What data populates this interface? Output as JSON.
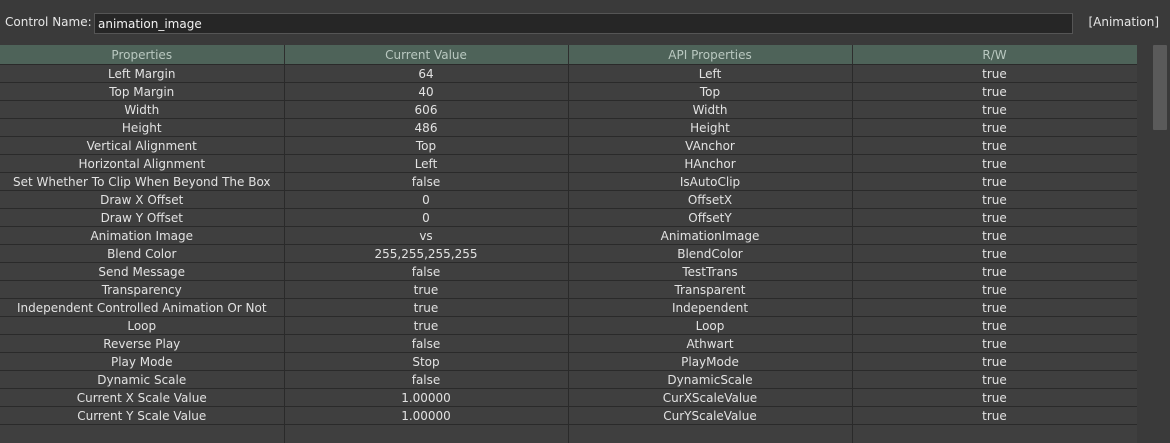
{
  "header": {
    "control_name_label": "Control Name:",
    "control_name_value": "animation_image",
    "type_tag": "[Animation]"
  },
  "table": {
    "columns": [
      "Properties",
      "Current Value",
      "API Properties",
      "R/W"
    ],
    "rows": [
      [
        "Left Margin",
        "64",
        "Left",
        "true"
      ],
      [
        "Top Margin",
        "40",
        "Top",
        "true"
      ],
      [
        "Width",
        "606",
        "Width",
        "true"
      ],
      [
        "Height",
        "486",
        "Height",
        "true"
      ],
      [
        "Vertical Alignment",
        "Top",
        "VAnchor",
        "true"
      ],
      [
        "Horizontal Alignment",
        "Left",
        "HAnchor",
        "true"
      ],
      [
        "Set Whether To Clip When Beyond The Box",
        "false",
        "IsAutoClip",
        "true"
      ],
      [
        "Draw X Offset",
        "0",
        "OffsetX",
        "true"
      ],
      [
        "Draw Y Offset",
        "0",
        "OffsetY",
        "true"
      ],
      [
        "Animation Image",
        "vs",
        "AnimationImage",
        "true"
      ],
      [
        "Blend Color",
        "255,255,255,255",
        "BlendColor",
        "true"
      ],
      [
        "Send Message",
        "false",
        "TestTrans",
        "true"
      ],
      [
        "Transparency",
        "true",
        "Transparent",
        "true"
      ],
      [
        "Independent Controlled Animation Or Not",
        "true",
        "Independent",
        "true"
      ],
      [
        "Loop",
        "true",
        "Loop",
        "true"
      ],
      [
        "Reverse Play",
        "false",
        "Athwart",
        "true"
      ],
      [
        "Play Mode",
        "Stop",
        "PlayMode",
        "true"
      ],
      [
        "Dynamic Scale",
        "false",
        "DynamicScale",
        "true"
      ],
      [
        "Current X Scale Value",
        "1.00000",
        "CurXScaleValue",
        "true"
      ],
      [
        "Current Y Scale Value",
        "1.00000",
        "CurYScaleValue",
        "true"
      ]
    ]
  },
  "colors": {
    "header_bg": "#4e6359",
    "header_text": "#b9c8c0",
    "panel_bg": "#3f3f3f",
    "grid_line": "#2a2a2a"
  }
}
